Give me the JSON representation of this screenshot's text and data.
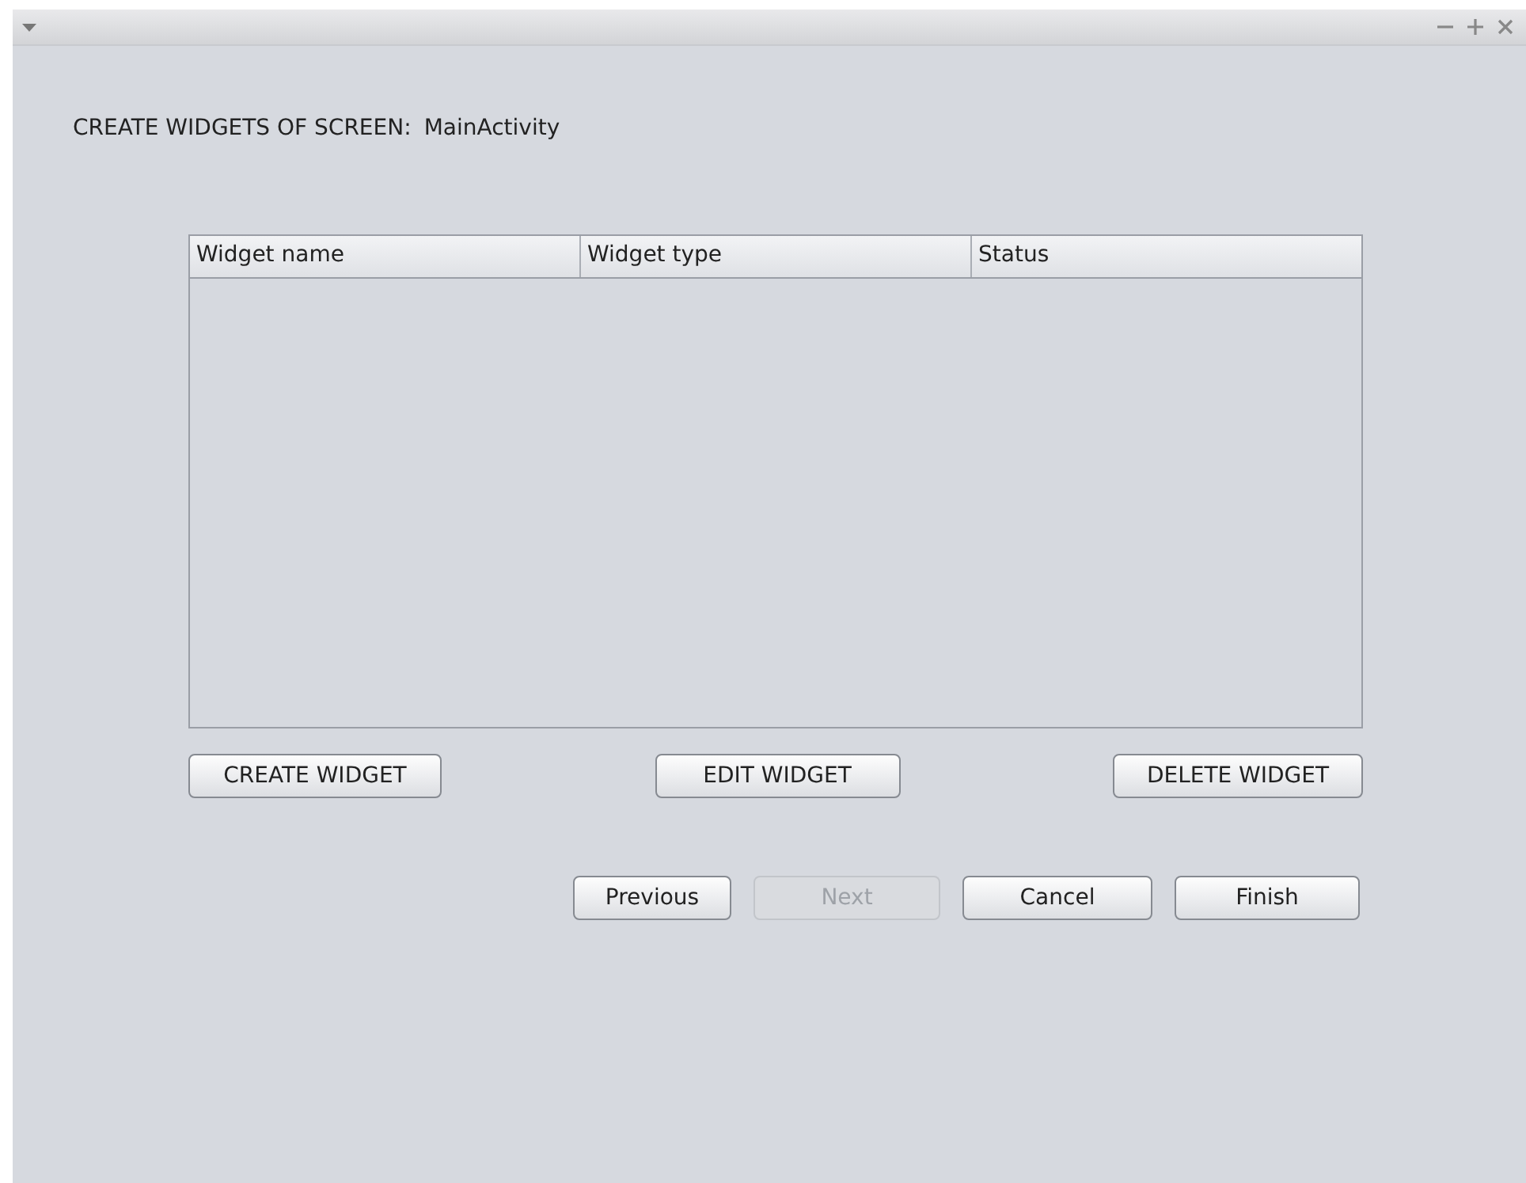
{
  "heading": {
    "label": "CREATE WIDGETS OF SCREEN:",
    "screen": "MainActivity"
  },
  "table": {
    "columns": [
      "Widget name",
      "Widget type",
      "Status"
    ]
  },
  "widget_buttons": [
    {
      "label": "CREATE WIDGET"
    },
    {
      "label": "EDIT WIDGET"
    },
    {
      "label": "DELETE WIDGET"
    }
  ],
  "nav_buttons": [
    {
      "label": "Previous",
      "disabled": false
    },
    {
      "label": "Next",
      "disabled": true
    },
    {
      "label": "Cancel",
      "disabled": false
    },
    {
      "label": "Finish",
      "disabled": false
    }
  ]
}
